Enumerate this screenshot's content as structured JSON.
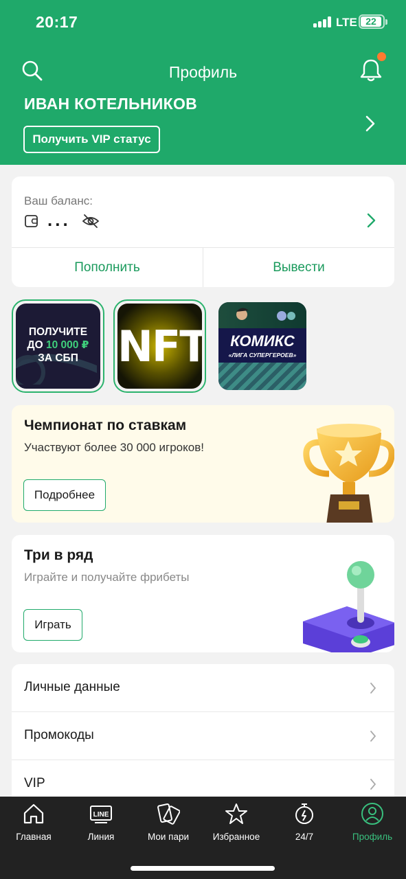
{
  "status_bar": {
    "time": "20:17",
    "network": "LTE",
    "battery": "22"
  },
  "header": {
    "title": "Профиль",
    "user_name": "ИВАН КОТЕЛЬНИКОВ",
    "vip_button": "Получить VIP статус",
    "brand_color": "#1fa96a",
    "notification_dot_color": "#ff7a30"
  },
  "balance": {
    "label": "Ваш баланс:",
    "hidden_value": "...",
    "topup_label": "Пополнить",
    "withdraw_label": "Вывести"
  },
  "stories": [
    {
      "line1": "ПОЛУЧИТЕ",
      "line2_prefix": "ДО ",
      "line2_accent": "10 000 ₽",
      "line3": "ЗА СБП"
    },
    {
      "text": "NFT"
    },
    {
      "title": "КОМИКС",
      "subtitle": "«ЛИГА СУПЕРГЕРОЕВ»"
    }
  ],
  "championship": {
    "title": "Чемпионат по ставкам",
    "subtitle": "Участвуют более 30 000 игроков!",
    "button": "Подробнее"
  },
  "three_in_row": {
    "title": "Три в ряд",
    "subtitle": "Играйте и получайте фрибеты",
    "button": "Играть"
  },
  "menu": [
    {
      "label": "Личные данные"
    },
    {
      "label": "Промокоды"
    },
    {
      "label": "VIP"
    }
  ],
  "tabbar": {
    "active_color": "#39c07e",
    "tabs": [
      {
        "label": "Главная",
        "icon": "home-icon"
      },
      {
        "label": "Линия",
        "icon": "line-icon",
        "badge_text": "LINE"
      },
      {
        "label": "Мои пари",
        "icon": "tickets-icon"
      },
      {
        "label": "Избранное",
        "icon": "star-icon"
      },
      {
        "label": "24/7",
        "icon": "stopwatch-icon"
      },
      {
        "label": "Профиль",
        "icon": "profile-icon",
        "active": true
      }
    ]
  }
}
